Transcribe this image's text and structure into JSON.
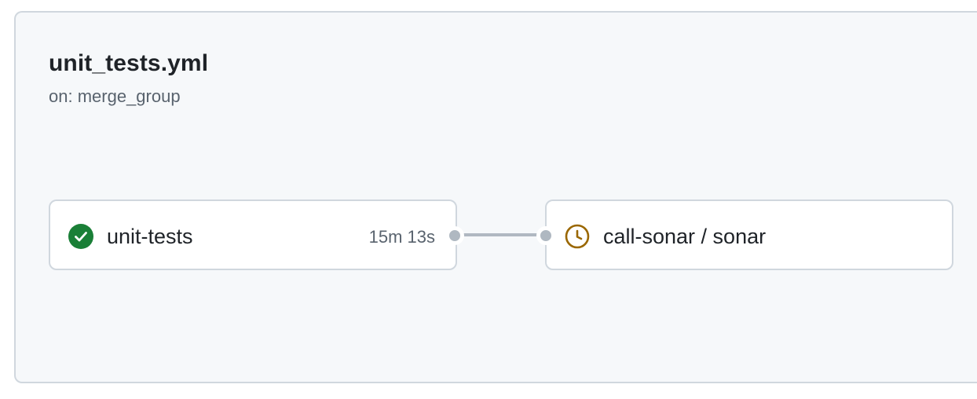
{
  "workflow": {
    "title": "unit_tests.yml",
    "trigger": "on: merge_group"
  },
  "jobs": [
    {
      "name": "unit-tests",
      "status": "success",
      "status_icon": "check-circle-fill-icon",
      "status_color": "#1a7f37",
      "duration": "15m 13s"
    },
    {
      "name": "call-sonar / sonar",
      "status": "queued",
      "status_icon": "clock-icon",
      "status_color": "#9a6700",
      "duration": ""
    }
  ],
  "colors": {
    "panel_background": "#f6f8fa",
    "border": "#d0d7de",
    "connector": "#afb8c1"
  }
}
